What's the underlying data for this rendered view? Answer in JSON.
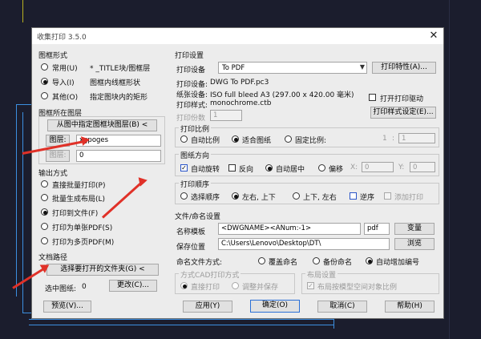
{
  "window": {
    "title": "收集打印 3.5.0",
    "close_glyph": "✕"
  },
  "sections": {
    "print_form": "图框形式",
    "print_layer": "图框所在图层",
    "output_mode": "输出方式",
    "folder": "文档路径",
    "print_settings": "打印设置",
    "print_scale": "打印比例",
    "print_offset": "图纸方向",
    "print_order": "打印顺序",
    "doc_options": "文件/命名设置",
    "saved_options": "命名文件方式",
    "layout": "布局设置",
    "preview_mode": "方式CAD打印方式"
  },
  "frame_type": {
    "options": [
      {
        "label": "常用(U)",
        "extra": "* _TITLE块/图框层",
        "checked": false
      },
      {
        "label": "导入(I)",
        "extra": "图框内线框形状",
        "checked": true
      },
      {
        "label": "其他(O)",
        "extra": "指定图块内的矩形",
        "checked": false
      }
    ]
  },
  "frame_layer": {
    "select_button": "从图中指定图框块图层(B) <",
    "layer_label": "图层:",
    "layer_value": "xgpoges",
    "block_label": "图层:",
    "block_value": "0"
  },
  "output": {
    "options": [
      {
        "label": "直接批量打印(P)",
        "checked": false
      },
      {
        "label": "批量生成布局(L)",
        "checked": false
      },
      {
        "label": "打印到文件(F)",
        "checked": true
      },
      {
        "label": "打印为单张PDF(S)",
        "checked": false
      },
      {
        "label": "打印为多页PDF(M)",
        "checked": false
      }
    ]
  },
  "folder": {
    "select_button": "选择要打开的文件夹(G) <",
    "count_label": "选中图纸:",
    "count_value": "0",
    "change_button": "更改(C)..."
  },
  "settings": {
    "printer_label": "打印设备",
    "printer_value": "To PDF",
    "props_button": "打印特性(A)...",
    "device_label": "打印设备:",
    "device_value": "DWG To PDF.pc3",
    "paper_label": "纸张设备:",
    "paper_value": "ISO full bleed A3 (297.00 x 420.00 毫米)",
    "style_label": "打印样式:",
    "style_value": "monochrome.ctb",
    "copies_label": "打印份数",
    "copies_value": "1",
    "open_label": "打开打印驱动",
    "style_button": "打印样式设定(E)..."
  },
  "scale": {
    "options": [
      {
        "label": "自动比例",
        "checked": false
      },
      {
        "label": "适合图纸",
        "checked": true
      },
      {
        "label": "固定比例:",
        "checked": false
      }
    ],
    "value_left": "1",
    "sep": ":",
    "value_right": "1"
  },
  "orientation": {
    "auto_label": "自动旋转",
    "auto_checked": true,
    "reverse_label": "反向",
    "reverse_checked": false,
    "center_label": "自动居中",
    "center_checked": true,
    "offset_label": "偏移",
    "offset_checked": false,
    "x_label": "X:",
    "x_value": "0",
    "y_label": "Y:",
    "y_value": "0"
  },
  "order": {
    "options": [
      {
        "label": "选择顺序",
        "checked": false
      },
      {
        "label": "左右, 上下",
        "checked": true
      },
      {
        "label": "上下, 左右",
        "checked": false
      }
    ],
    "reverse_label": "逆序",
    "reverse_checked": false,
    "merge_label": "添加打印",
    "merge_checked": false
  },
  "naming": {
    "name_label": "名称模板",
    "name_value": "<DWGNAME><ANum:-1>",
    "name_unit": "pdf",
    "name_button": "变量",
    "path_label": "保存位置",
    "path_value": "C:\\Users\\Lenovo\\Desktop\\DT\\",
    "path_button": "浏览",
    "mode_label": "命名文件方式:",
    "mode_options": [
      {
        "label": "覆盖命名",
        "checked": false
      },
      {
        "label": "备份命名",
        "checked": false
      },
      {
        "label": "自动增加编号",
        "checked": true
      }
    ]
  },
  "preview": {
    "options": [
      {
        "label": "直接打印",
        "checked": true
      },
      {
        "label": "调整并保存",
        "checked": false
      }
    ]
  },
  "layout": {
    "check_label": "布局按模型空间对象比例",
    "checked": true
  },
  "footer": {
    "preview_button": "预览(V)...",
    "apply_button": "应用(Y)",
    "ok_button": "确定(O)",
    "cancel_button": "取消(C)",
    "help_button": "帮助(H)"
  },
  "colors": {
    "arrow": "#e03128",
    "cad_line": "#3c8fe0"
  }
}
